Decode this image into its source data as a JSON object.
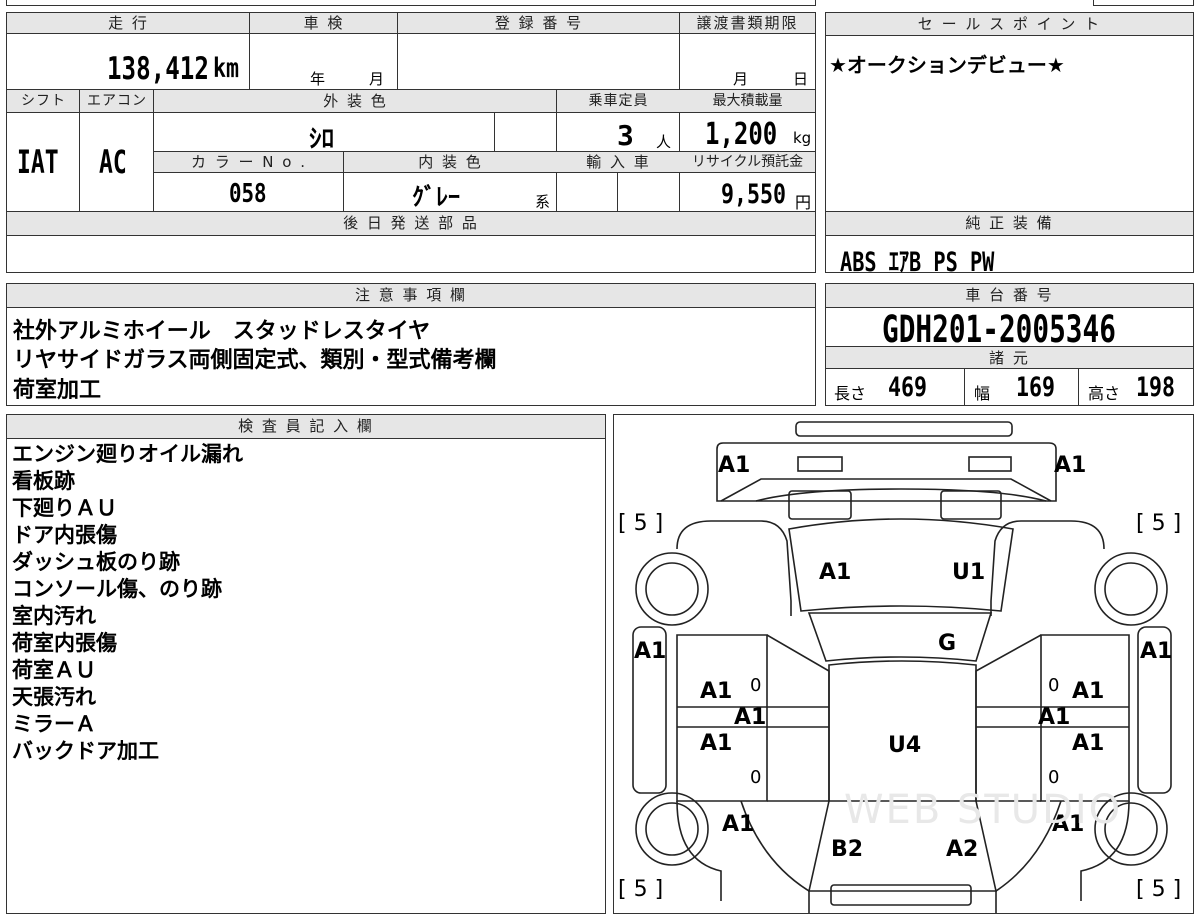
{
  "headers": {
    "mileage": "走 行",
    "inspection": "車 検",
    "registration_no": "登 録 番 号",
    "transfer_deadline": "譲渡書類期限",
    "sales_points": "セ ー ル ス ポ イ ン ト",
    "shift": "シフト",
    "aircon": "エアコン",
    "exterior_color": "外 装 色",
    "capacity": "乗車定員",
    "max_load": "最大積載量",
    "color_no": "カ ラ ー N o .",
    "interior_color": "内 装 色",
    "import": "輸 入 車",
    "recycle_deposit": "リサイクル預託金",
    "later_parts": "後 日 発 送 部 品",
    "genuine_equipment": "純 正 装 備",
    "notes": "注 意 事 項 欄",
    "chassis_no": "車 台 番 号",
    "specs": "諸 元",
    "inspector": "検 査 員 記 入 欄"
  },
  "vehicle": {
    "mileage": "138,412",
    "mileage_unit": "km",
    "inspection_year_unit": "年",
    "inspection_month_unit": "月",
    "deadline_month_unit": "月",
    "deadline_day_unit": "日",
    "shift": "IAT",
    "aircon": "AC",
    "exterior_color": "ｼﾛ",
    "capacity": "3",
    "capacity_unit": "人",
    "max_load": "1,200",
    "max_load_unit": "kg",
    "color_no": "058",
    "interior_color": "ｸﾞﾚｰ",
    "interior_suffix": "系",
    "recycle_deposit": "9,550",
    "recycle_unit": "円",
    "chassis_no": "GDH201-2005346"
  },
  "sales_point": "★オークションデビュー★",
  "genuine_equipment": "ABS ｴｱB PS PW",
  "notes": [
    "社外アルミホイール　スタッドレスタイヤ",
    "リヤサイドガラス両側固定式、類別・型式備考欄",
    "荷室加工"
  ],
  "specs": {
    "length_label": "長さ",
    "length": "469",
    "width_label": "幅",
    "width": "169",
    "height_label": "高さ",
    "height": "198"
  },
  "inspector_notes": [
    "エンジン廻りオイル漏れ",
    "看板跡",
    "下廻りＡＵ",
    "ドア内張傷",
    "ダッシュ板のり跡",
    "コンソール傷、のり跡",
    "室内汚れ",
    "荷室内張傷",
    "荷室ＡＵ",
    "天張汚れ",
    "ミラーＡ",
    "バックドア加工"
  ],
  "damage_codes": {
    "front_left": "A1",
    "front_right": "A1",
    "bracket_tl": "[ 5 ]",
    "bracket_tr": "[ 5 ]",
    "bracket_bl": "[ 5 ]",
    "bracket_br": "[ 5 ]",
    "hood_left": "A1",
    "hood_right": "U1",
    "windshield": "G",
    "left_side": "A1",
    "right_side": "A1",
    "ldoor_front": "A1",
    "ldoor_mid": "A1",
    "ldoor_rear": "A1",
    "rdoor_front": "A1",
    "rdoor_mid": "A1",
    "rdoor_rear": "A1",
    "roof": "U4",
    "rear_left": "A1",
    "rear_right": "A1",
    "back_left": "B2",
    "back_right": "A2",
    "zero": "0"
  },
  "watermark": "WEB STUDIO"
}
